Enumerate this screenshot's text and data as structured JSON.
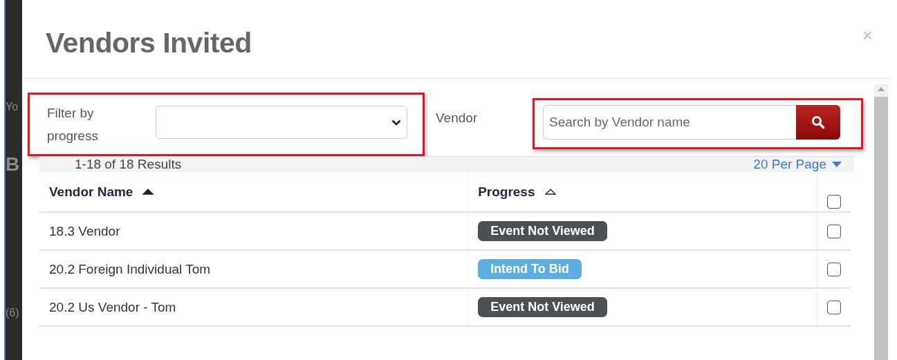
{
  "background_fragments": [
    "Yo",
    "B",
    "(6)"
  ],
  "modal": {
    "title": "Vendors Invited",
    "close": "×"
  },
  "filter": {
    "label": "Filter by progress",
    "highlighted": true
  },
  "vendor_search": {
    "label": "Vendor",
    "placeholder": "Search by Vendor name",
    "highlighted": true
  },
  "results": {
    "summary": "1-18 of 18 Results",
    "per_page": "20 Per Page"
  },
  "table": {
    "columns": [
      {
        "label": "Vendor Name",
        "sorted": true
      },
      {
        "label": "Progress",
        "sorted": false
      }
    ],
    "select_all": {
      "checked": false
    },
    "rows": [
      {
        "name": "18.3 Vendor",
        "progress": {
          "label": "Event Not Viewed",
          "color": "#4b5055"
        },
        "checked": false
      },
      {
        "name": "20.2 Foreign Individual Tom",
        "progress": {
          "label": "Intend To Bid",
          "color": "#5cade0"
        },
        "checked": false
      },
      {
        "name": "20.2 Us Vendor - Tom",
        "progress": {
          "label": "Event Not Viewed",
          "color": "#4b5055"
        },
        "checked": false
      }
    ]
  }
}
